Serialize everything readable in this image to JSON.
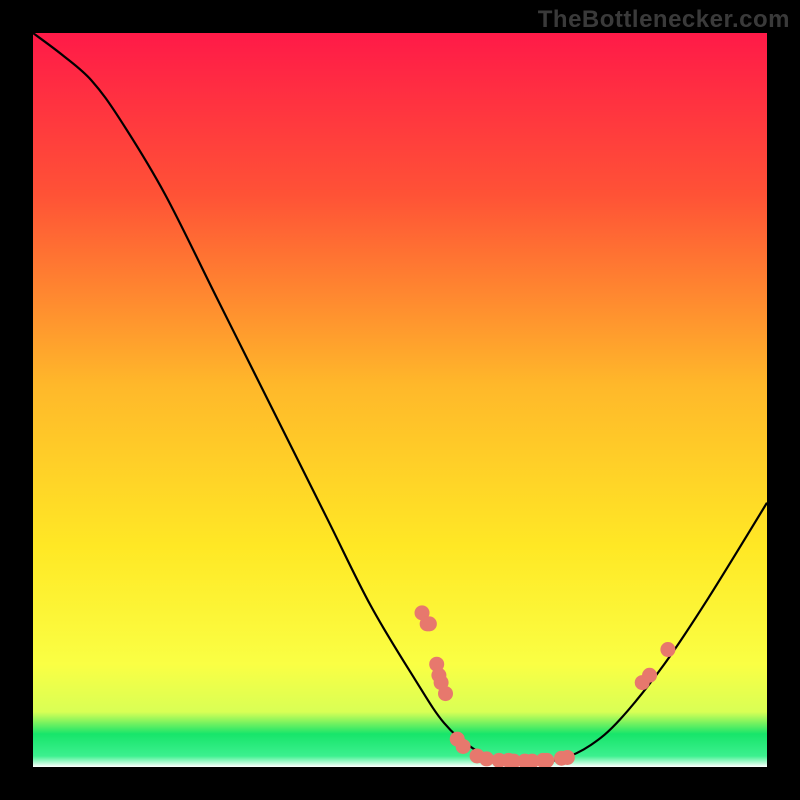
{
  "watermark": "TheBottlenecker.com",
  "colors": {
    "background": "#000000",
    "curve": "#000000",
    "marker": "#e7786d",
    "gradient_top": "#ff1a48",
    "gradient_mid_top": "#ff6a36",
    "gradient_mid": "#ffe825",
    "gradient_low": "#f8ff3a",
    "gradient_band": "#17e56a",
    "gradient_bottom": "#ffffff"
  },
  "chart_data": {
    "type": "line",
    "title": "",
    "xlabel": "",
    "ylabel": "",
    "xlim": [
      0,
      100
    ],
    "ylim": [
      0,
      100
    ],
    "curve": [
      {
        "x": 0,
        "y": 100
      },
      {
        "x": 4,
        "y": 97
      },
      {
        "x": 8,
        "y": 93.5
      },
      {
        "x": 12,
        "y": 88
      },
      {
        "x": 18,
        "y": 78
      },
      {
        "x": 25,
        "y": 64
      },
      {
        "x": 32,
        "y": 50
      },
      {
        "x": 40,
        "y": 34
      },
      {
        "x": 46,
        "y": 22
      },
      {
        "x": 52,
        "y": 12
      },
      {
        "x": 56,
        "y": 6
      },
      {
        "x": 60,
        "y": 2.5
      },
      {
        "x": 64,
        "y": 1
      },
      {
        "x": 68,
        "y": 0.7
      },
      {
        "x": 72,
        "y": 1.1
      },
      {
        "x": 76,
        "y": 3
      },
      {
        "x": 80,
        "y": 6.5
      },
      {
        "x": 86,
        "y": 14
      },
      {
        "x": 92,
        "y": 23
      },
      {
        "x": 100,
        "y": 36
      }
    ],
    "markers": [
      {
        "x": 53,
        "y": 21
      },
      {
        "x": 53.7,
        "y": 19.5
      },
      {
        "x": 54,
        "y": 19.5
      },
      {
        "x": 55,
        "y": 14
      },
      {
        "x": 55.3,
        "y": 12.5
      },
      {
        "x": 55.6,
        "y": 11.5
      },
      {
        "x": 56.2,
        "y": 10
      },
      {
        "x": 57.8,
        "y": 3.8
      },
      {
        "x": 58.6,
        "y": 2.8
      },
      {
        "x": 60.5,
        "y": 1.5
      },
      {
        "x": 61.8,
        "y": 1.1
      },
      {
        "x": 63.5,
        "y": 0.9
      },
      {
        "x": 64.8,
        "y": 0.9
      },
      {
        "x": 65.5,
        "y": 0.8
      },
      {
        "x": 67.0,
        "y": 0.8
      },
      {
        "x": 68.0,
        "y": 0.8
      },
      {
        "x": 69.5,
        "y": 0.9
      },
      {
        "x": 70.0,
        "y": 0.9
      },
      {
        "x": 72.0,
        "y": 1.2
      },
      {
        "x": 72.8,
        "y": 1.3
      },
      {
        "x": 83.0,
        "y": 11.5
      },
      {
        "x": 84.0,
        "y": 12.5
      },
      {
        "x": 86.5,
        "y": 16
      }
    ],
    "gradient_stops": [
      {
        "offset": 0.0,
        "color": "#ff1a48"
      },
      {
        "offset": 0.22,
        "color": "#ff5236"
      },
      {
        "offset": 0.48,
        "color": "#ffb82a"
      },
      {
        "offset": 0.7,
        "color": "#ffe825"
      },
      {
        "offset": 0.86,
        "color": "#faff44"
      },
      {
        "offset": 0.925,
        "color": "#d9ff55"
      },
      {
        "offset": 0.955,
        "color": "#17e56a"
      },
      {
        "offset": 0.985,
        "color": "#3cf08f"
      },
      {
        "offset": 1.0,
        "color": "#ffffff"
      }
    ]
  }
}
